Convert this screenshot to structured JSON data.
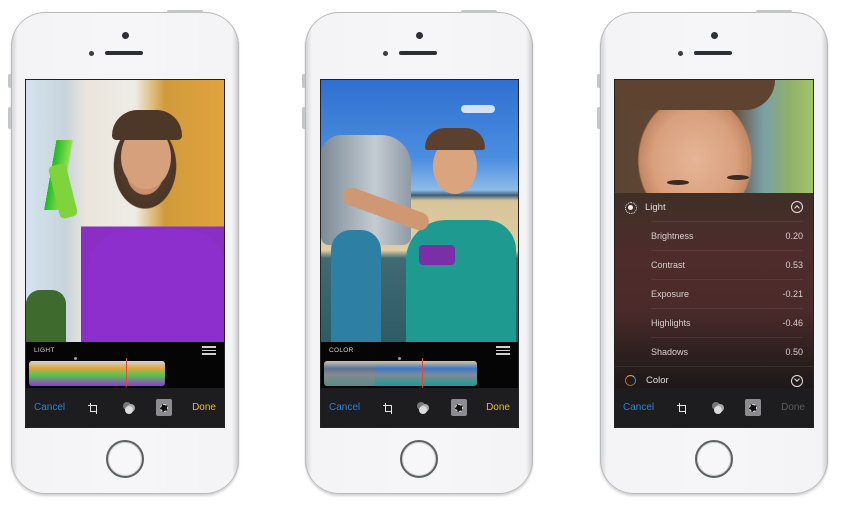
{
  "phones": [
    {
      "mode": "filmstrip",
      "editor_label": "LIGHT",
      "toolbar": {
        "cancel": "Cancel",
        "done": "Done",
        "done_enabled": true
      },
      "photo_description": "Girl in purple shirt holding green popsicle on porch",
      "filmstrip_frames": 8
    },
    {
      "mode": "filmstrip",
      "editor_label": "COLOR",
      "toolbar": {
        "cancel": "Cancel",
        "done": "Done",
        "done_enabled": true
      },
      "photo_description": "Girl in teal polka-dot shirt at beach binocular viewer",
      "filmstrip_frames": 9
    },
    {
      "mode": "panel",
      "toolbar": {
        "cancel": "Cancel",
        "done": "Done",
        "done_enabled": false
      },
      "photo_description": "Close-up of girl's face",
      "panel": {
        "light": {
          "label": "Light",
          "expanded": true
        },
        "rows": [
          {
            "name": "Brightness",
            "value": "0.20"
          },
          {
            "name": "Contrast",
            "value": "0.53"
          },
          {
            "name": "Exposure",
            "value": "-0.21"
          },
          {
            "name": "Highlights",
            "value": "-0.46"
          },
          {
            "name": "Shadows",
            "value": "0.50"
          }
        ],
        "color": {
          "label": "Color",
          "expanded": false
        }
      }
    }
  ],
  "colors": {
    "cancel": "#2f7fd6",
    "done": "#e6c20f",
    "done_disabled": "#5b5b5e",
    "marker": "#e4463a"
  }
}
